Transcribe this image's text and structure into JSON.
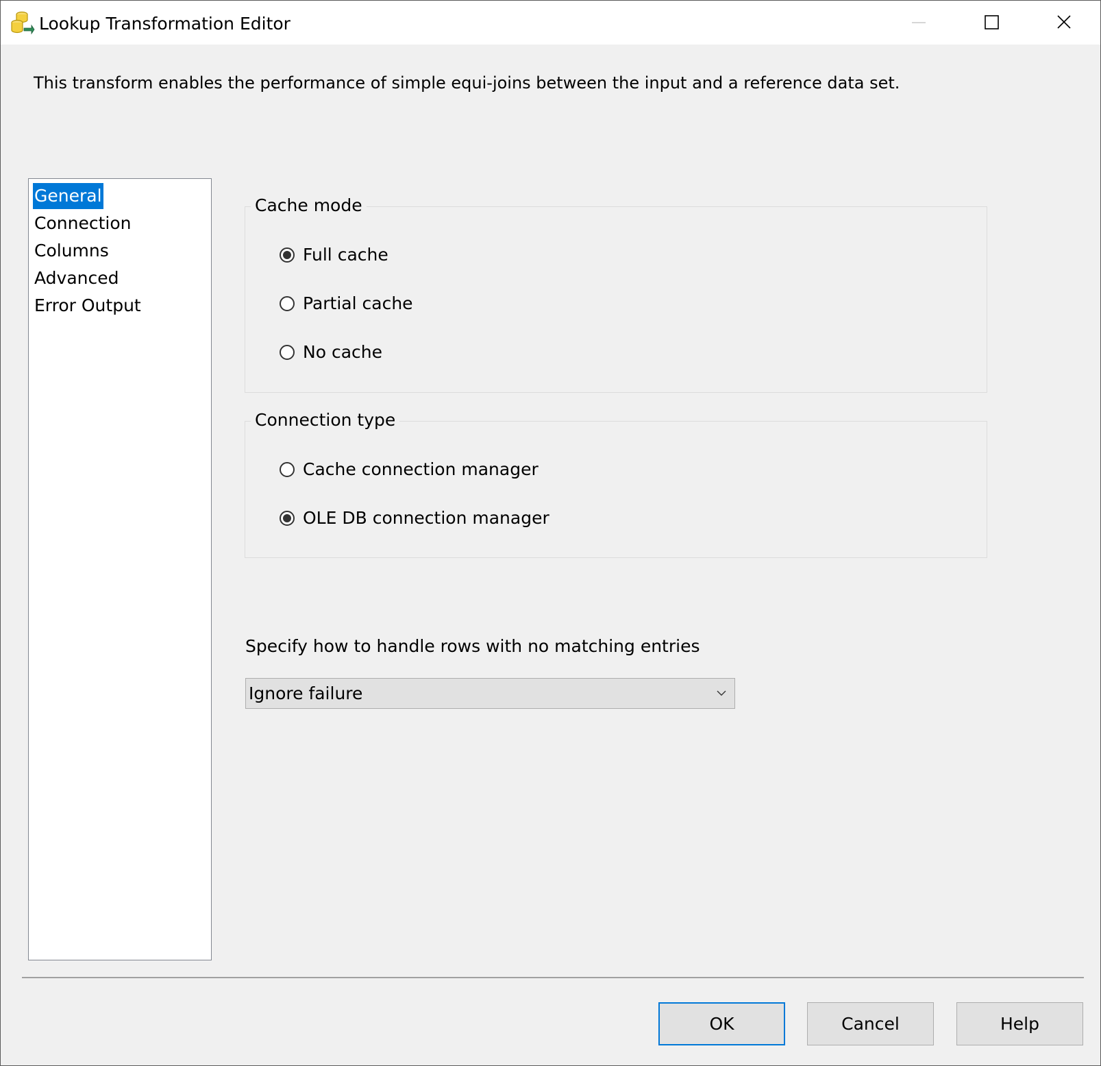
{
  "window": {
    "title": "Lookup Transformation Editor",
    "icon": "database-lookup-icon"
  },
  "description": "This transform enables the performance of simple equi-joins between the input and a reference data set.",
  "nav": {
    "items": [
      {
        "label": "General",
        "selected": true
      },
      {
        "label": "Connection",
        "selected": false
      },
      {
        "label": "Columns",
        "selected": false
      },
      {
        "label": "Advanced",
        "selected": false
      },
      {
        "label": "Error Output",
        "selected": false
      }
    ]
  },
  "cache_mode": {
    "title": "Cache mode",
    "options": [
      {
        "label": "Full cache",
        "checked": true
      },
      {
        "label": "Partial cache",
        "checked": false
      },
      {
        "label": "No cache",
        "checked": false
      }
    ]
  },
  "connection_type": {
    "title": "Connection type",
    "options": [
      {
        "label": "Cache connection manager",
        "checked": false
      },
      {
        "label": "OLE DB connection manager",
        "checked": true
      }
    ]
  },
  "no_match": {
    "label": "Specify how to handle rows with no matching entries",
    "selected": "Ignore failure"
  },
  "buttons": {
    "ok": "OK",
    "cancel": "Cancel",
    "help": "Help"
  },
  "colors": {
    "selection": "#0078d7",
    "dialog_background": "#f0f0f0"
  }
}
